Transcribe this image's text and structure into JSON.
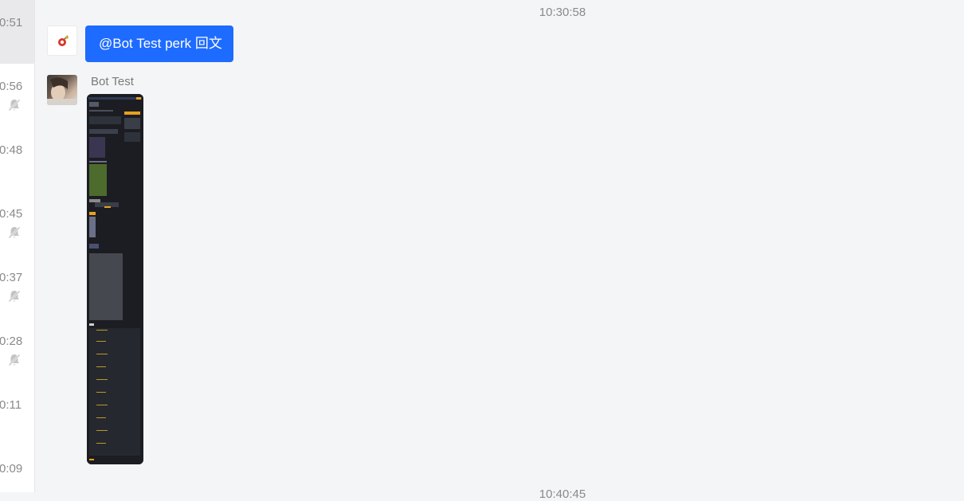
{
  "sidebar": {
    "items": [
      {
        "time": "0:51",
        "muted": false,
        "active": true
      },
      {
        "time": "0:56",
        "muted": true,
        "active": false
      },
      {
        "time": "0:48",
        "muted": false,
        "active": false
      },
      {
        "time": "0:45",
        "muted": true,
        "active": false
      },
      {
        "time": "0:37",
        "muted": true,
        "active": false
      },
      {
        "time": "0:28",
        "muted": true,
        "active": false
      },
      {
        "time": "0:11",
        "muted": false,
        "active": false
      },
      {
        "time": "0:09",
        "muted": false,
        "active": false
      }
    ]
  },
  "chat": {
    "timestamp_top": "10:30:58",
    "timestamp_bottom": "10:40:45",
    "outgoing_message": "@Bot Test perk 回文",
    "incoming_sender": "Bot Test",
    "incoming_image_icon": "screenshot-thumbnail"
  },
  "colors": {
    "bubble": "#1e6bff",
    "background": "#f4f5f7",
    "sidebar_active": "#e9e9eb",
    "image_bg": "#1c1d22"
  }
}
